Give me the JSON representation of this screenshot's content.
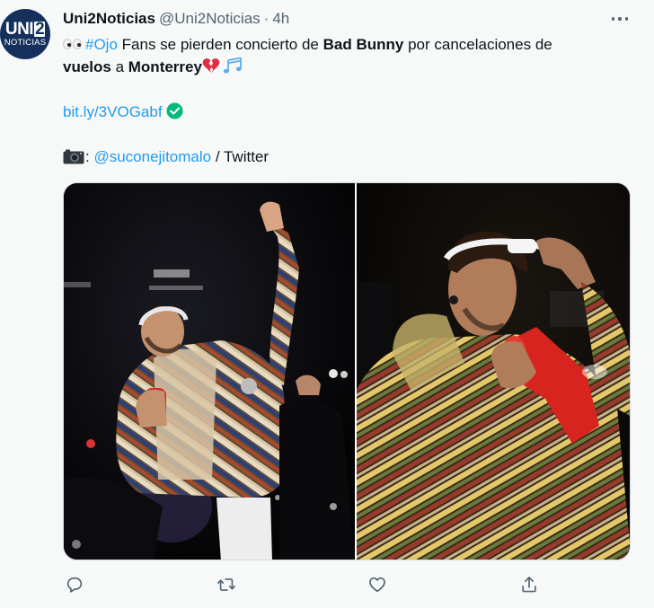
{
  "tweet": {
    "author": {
      "display_name": "Uni2Noticias",
      "handle": "@Uni2Noticias",
      "separator": "·",
      "time": "4h",
      "avatar": {
        "logo_main": "UNI",
        "logo_num": "2",
        "logo_sub": "NOTICIAS",
        "color": "#16305c"
      }
    },
    "body": {
      "hashtag": "#Ojo",
      "line1_text": " Fans se pierden concierto de ",
      "bold1": "Bad Bunny",
      "line1_tail": " por cancelaciones de",
      "bold2": "vuelos",
      "line2_mid": " a ",
      "bold3": "Monterrey",
      "link": "bit.ly/3VOGabf",
      "credit_prefix": ": ",
      "mention": "@suconejitomalo",
      "credit_suffix": " / Twitter",
      "emojis": [
        "eyes-emoji",
        "broken-heart-emoji",
        "musical-notes-emoji",
        "verified-check-emoji",
        "camera-emoji"
      ]
    },
    "media": {
      "photos": [
        {
          "description_icon": "concert-photo-raised-fist"
        },
        {
          "description_icon": "concert-photo-sunglasses"
        }
      ]
    },
    "actions": [
      "reply-icon",
      "retweet-icon",
      "like-icon",
      "share-icon"
    ],
    "colors": {
      "link": "#1d9bf0",
      "text": "#0f1419",
      "secondary": "#536471",
      "background": "#f7f9f9",
      "verified": "#00ba7c"
    }
  }
}
